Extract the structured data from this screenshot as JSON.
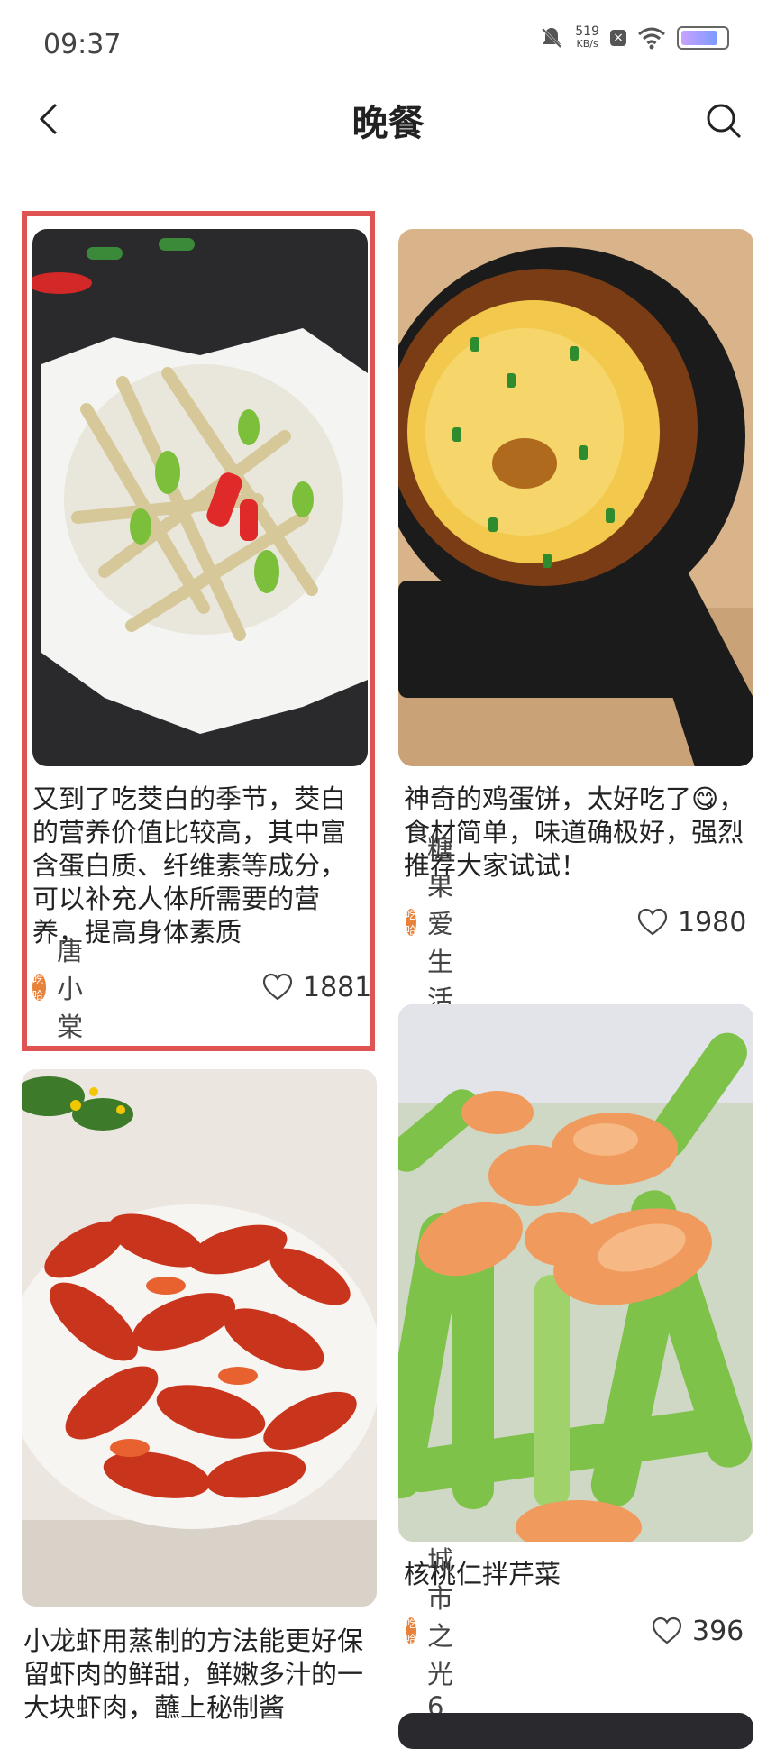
{
  "status": {
    "time": "09:37",
    "net_speed_value": "519",
    "net_speed_unit": "KB/s",
    "battery_level": 0.9
  },
  "header": {
    "title": "晚餐"
  },
  "avatar_text": "吃哈",
  "cards": [
    {
      "caption": "又到了吃茭白的季节，茭白的营养价值比较高，其中富含蛋白质、纤维素等成分，可以补充人体所需要的营养，提高身体素质",
      "author": "唐小棠",
      "likes": "1881"
    },
    {
      "caption": "神奇的鸡蛋饼，太好吃了😋，食材简单，味道确极好，强烈推荐大家试试！",
      "author": "糖果爱生活",
      "likes": "1980"
    },
    {
      "caption": "小龙虾用蒸制的方法能更好保留虾肉的鲜甜，鲜嫩多汁的一大块虾肉，蘸上秘制酱",
      "author": "",
      "likes": ""
    },
    {
      "caption": "核桃仁拌芹菜",
      "author": "城市之光6",
      "likes": "396"
    }
  ]
}
